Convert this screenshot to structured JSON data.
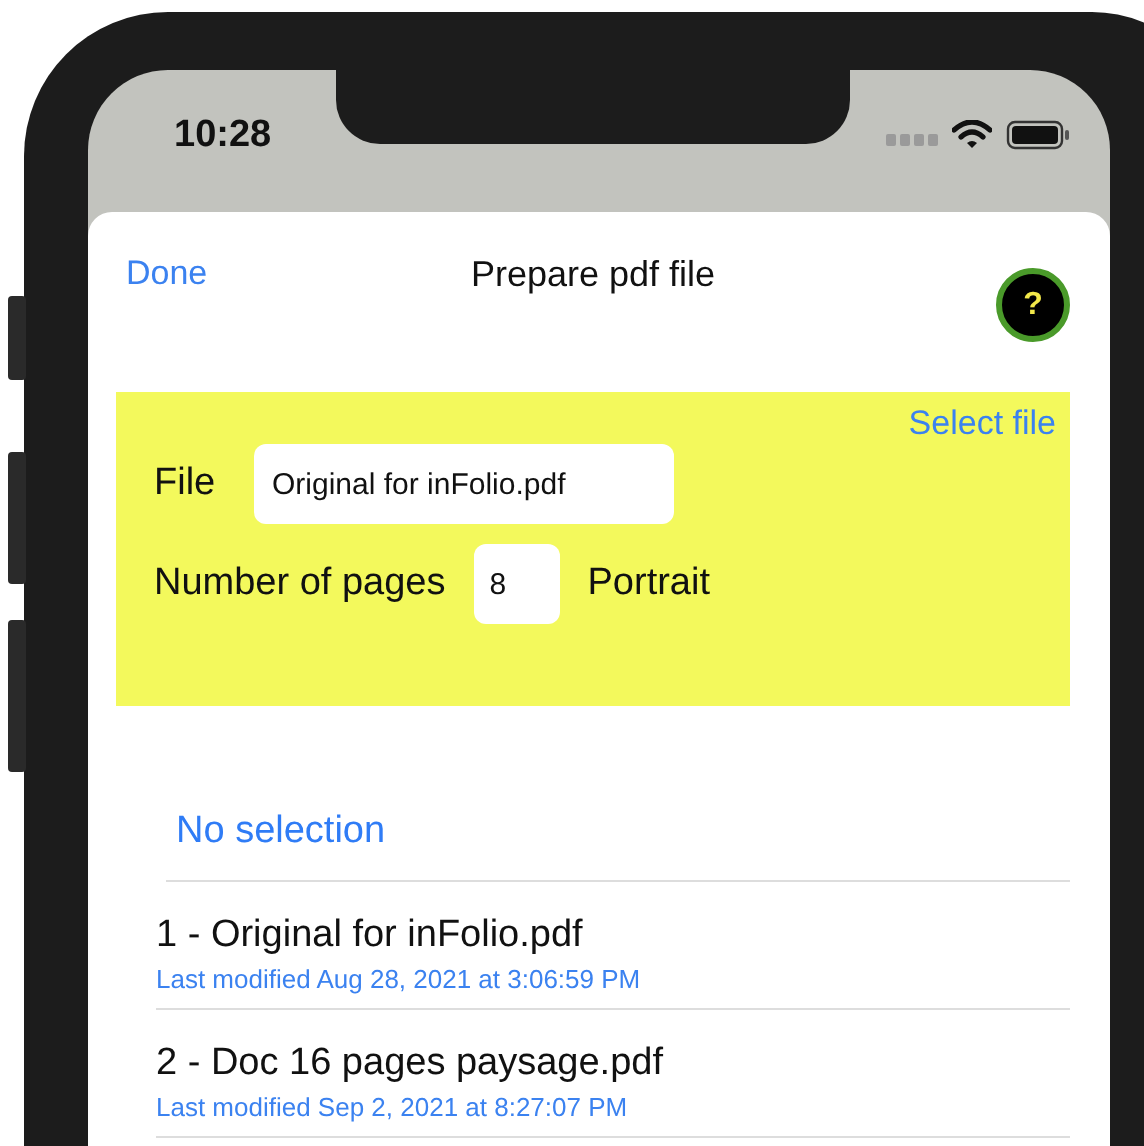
{
  "status_bar": {
    "time": "10:28"
  },
  "sheet": {
    "done_button": "Done",
    "title": "Prepare pdf file",
    "help_button": "?"
  },
  "file_panel": {
    "select_file_link": "Select file",
    "file_label": "File",
    "file_value": "Original for inFolio.pdf",
    "pages_label": "Number of pages",
    "pages_value": "8",
    "orientation": "Portrait"
  },
  "list": {
    "no_selection": "No selection",
    "files": [
      {
        "name": "1 - Original for inFolio.pdf",
        "modified": "Last modified Aug 28, 2021 at 3:06:59 PM"
      },
      {
        "name": "2 - Doc 16 pages paysage.pdf",
        "modified": "Last modified Sep 2, 2021 at 8:27:07 PM"
      }
    ]
  }
}
